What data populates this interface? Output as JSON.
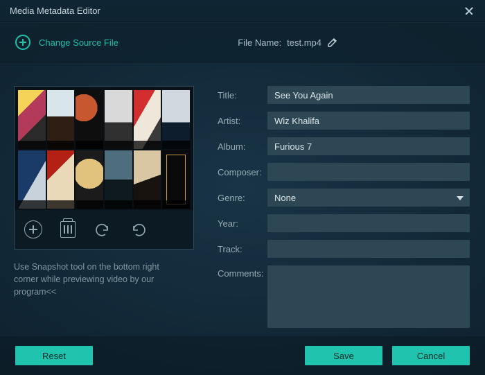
{
  "window": {
    "title": "Media Metadata Editor"
  },
  "sourcebar": {
    "change_label": "Change Source File",
    "filename_label": "File Name:",
    "filename_value": "test.mp4"
  },
  "hint": "Use Snapshot tool on the bottom right corner while previewing video by our program<<",
  "form": {
    "title": {
      "label": "Title:",
      "value": "See You Again"
    },
    "artist": {
      "label": "Artist:",
      "value": "Wiz Khalifa"
    },
    "album": {
      "label": "Album:",
      "value": "Furious 7"
    },
    "composer": {
      "label": "Composer:",
      "value": ""
    },
    "genre": {
      "label": "Genre:",
      "value": "None"
    },
    "year": {
      "label": "Year:",
      "value": ""
    },
    "track": {
      "label": "Track:",
      "value": ""
    },
    "comments": {
      "label": "Comments:",
      "value": ""
    }
  },
  "buttons": {
    "reset": "Reset",
    "save": "Save",
    "cancel": "Cancel"
  }
}
